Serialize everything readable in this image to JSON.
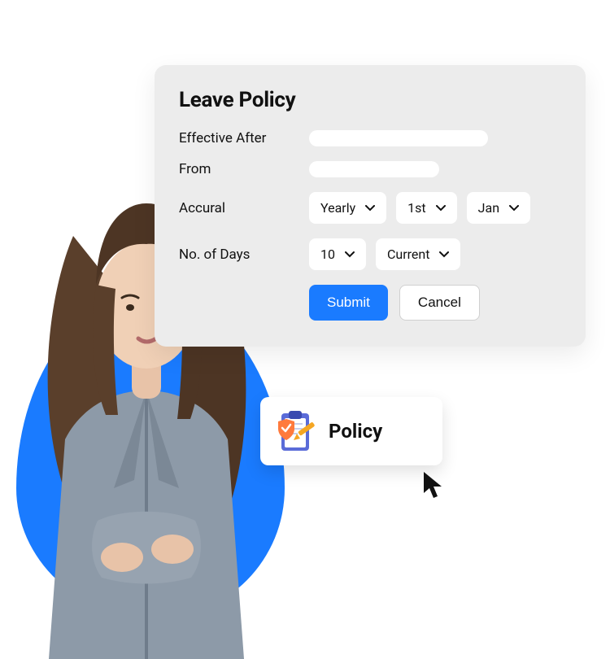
{
  "card": {
    "title": "Leave Policy",
    "rows": {
      "effective_after": {
        "label": "Effective After"
      },
      "from": {
        "label": "From"
      },
      "accrual": {
        "label": "Accural",
        "period": "Yearly",
        "day": "1st",
        "month": "Jan"
      },
      "no_of_days": {
        "label": "No. of Days",
        "count": "10",
        "mode": "Current"
      }
    },
    "buttons": {
      "submit": "Submit",
      "cancel": "Cancel"
    }
  },
  "policy_chip": {
    "label": "Policy"
  },
  "colors": {
    "accent": "#1a7bff",
    "card_bg": "#ececec"
  }
}
